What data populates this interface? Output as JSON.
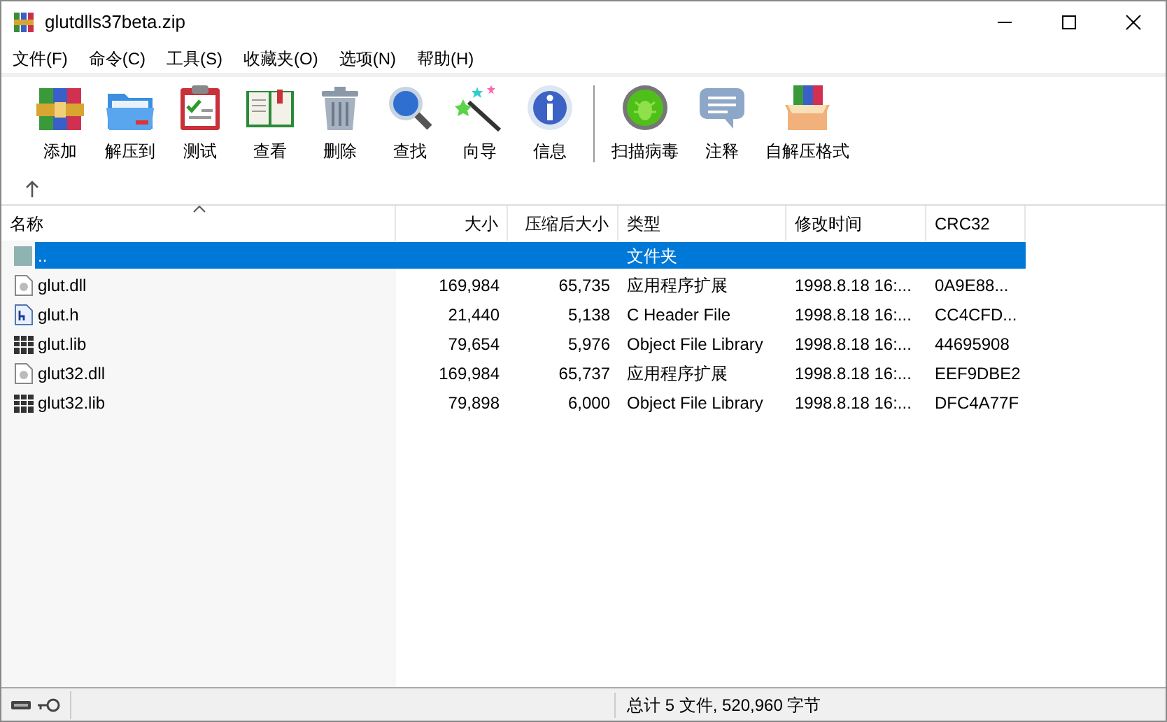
{
  "window": {
    "title": "glutdlls37beta.zip"
  },
  "menu": [
    "文件(F)",
    "命令(C)",
    "工具(S)",
    "收藏夹(O)",
    "选项(N)",
    "帮助(H)"
  ],
  "toolbar": [
    {
      "label": "添加",
      "kind": "add"
    },
    {
      "label": "解压到",
      "kind": "extract"
    },
    {
      "label": "测试",
      "kind": "test"
    },
    {
      "label": "查看",
      "kind": "view"
    },
    {
      "label": "删除",
      "kind": "delete"
    },
    {
      "label": "查找",
      "kind": "find"
    },
    {
      "label": "向导",
      "kind": "wizard"
    },
    {
      "label": "信息",
      "kind": "info"
    },
    {
      "label": "扫描病毒",
      "kind": "scan",
      "separator_before": true
    },
    {
      "label": "注释",
      "kind": "comment"
    },
    {
      "label": "自解压格式",
      "kind": "sfx"
    }
  ],
  "table": {
    "columns": [
      {
        "label": "名称",
        "sorted": true
      },
      {
        "label": "大小",
        "sorted": false
      },
      {
        "label": "压缩后大小",
        "sorted": false
      },
      {
        "label": "类型",
        "sorted": false
      },
      {
        "label": "修改时间",
        "sorted": false
      },
      {
        "label": "CRC32",
        "sorted": false
      }
    ],
    "rows": [
      {
        "kind": "folder",
        "selected": true,
        "cells": [
          "..",
          "",
          "",
          "文件夹",
          "",
          ""
        ]
      },
      {
        "kind": "dll",
        "selected": false,
        "cells": [
          "glut.dll",
          "169,984",
          "65,735",
          "应用程序扩展",
          "1998.8.18 16:...",
          "0A9E88..."
        ]
      },
      {
        "kind": "header",
        "selected": false,
        "cells": [
          "glut.h",
          "21,440",
          "5,138",
          "C Header File",
          "1998.8.18 16:...",
          "CC4CFD..."
        ]
      },
      {
        "kind": "lib",
        "selected": false,
        "cells": [
          "glut.lib",
          "79,654",
          "5,976",
          "Object File Library",
          "1998.8.18 16:...",
          "44695908"
        ]
      },
      {
        "kind": "dll",
        "selected": false,
        "cells": [
          "glut32.dll",
          "169,984",
          "65,737",
          "应用程序扩展",
          "1998.8.18 16:...",
          "EEF9DBE2"
        ]
      },
      {
        "kind": "lib",
        "selected": false,
        "cells": [
          "glut32.lib",
          "79,898",
          "6,000",
          "Object File Library",
          "1998.8.18 16:...",
          "DFC4A77F"
        ]
      }
    ]
  },
  "status_bar": {
    "text": "总计 5 文件, 520,960 字节"
  }
}
